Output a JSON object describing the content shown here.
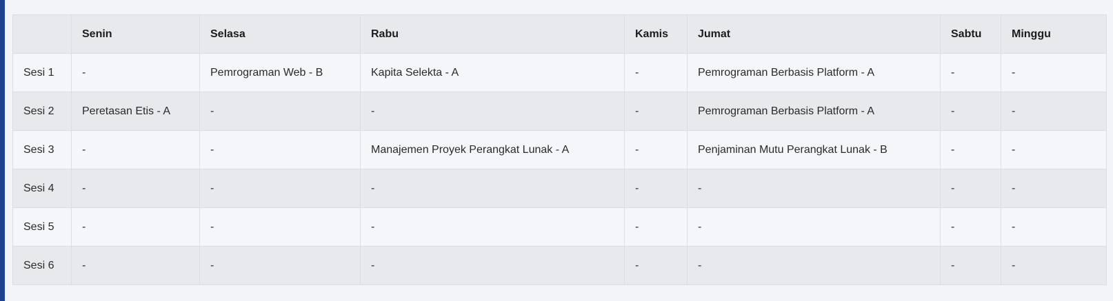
{
  "schedule": {
    "corner_header": "",
    "days": [
      "Senin",
      "Selasa",
      "Rabu",
      "Kamis",
      "Jumat",
      "Sabtu",
      "Minggu"
    ],
    "rows": [
      {
        "session": "Sesi 1",
        "cells": [
          "-",
          "Pemrograman Web - B",
          "Kapita Selekta - A",
          "-",
          "Pemrograman Berbasis Platform - A",
          "-",
          "-"
        ]
      },
      {
        "session": "Sesi 2",
        "cells": [
          "Peretasan Etis - A",
          "-",
          "-",
          "-",
          "Pemrograman Berbasis Platform - A",
          "-",
          "-"
        ]
      },
      {
        "session": "Sesi 3",
        "cells": [
          "-",
          "-",
          "Manajemen Proyek Perangkat Lunak - A",
          "-",
          "Penjaminan Mutu Perangkat Lunak - B",
          "-",
          "-"
        ]
      },
      {
        "session": "Sesi 4",
        "cells": [
          "-",
          "-",
          "-",
          "-",
          "-",
          "-",
          "-"
        ]
      },
      {
        "session": "Sesi 5",
        "cells": [
          "-",
          "-",
          "-",
          "-",
          "-",
          "-",
          "-"
        ]
      },
      {
        "session": "Sesi 6",
        "cells": [
          "-",
          "-",
          "-",
          "-",
          "-",
          "-",
          "-"
        ]
      }
    ]
  }
}
